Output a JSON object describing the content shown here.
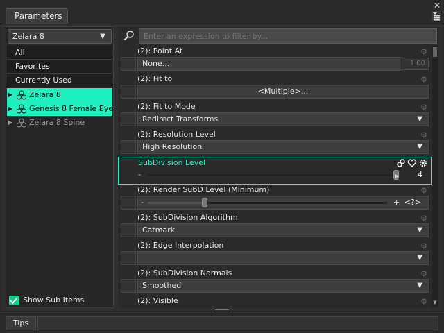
{
  "window": {
    "tab_label": "Parameters",
    "close_glyph": "✕"
  },
  "left": {
    "node_dropdown": "Zelara 8",
    "groups": [
      "All",
      "Favorites",
      "Currently Used"
    ],
    "tree": [
      {
        "label": "Zelara 8",
        "selected": true
      },
      {
        "label": "Genesis 8 Female Eye...",
        "selected": true
      },
      {
        "label": "Zelara 8 Spine",
        "selected": false
      }
    ],
    "show_sub_items": "Show Sub Items",
    "show_sub_checked": true
  },
  "filter": {
    "placeholder": "Enter an expression to filter by..."
  },
  "params": [
    {
      "label": "(2): Point At",
      "type": "text",
      "value": "None...",
      "num": "1.00"
    },
    {
      "label": "(2): Fit to",
      "type": "button",
      "value": "<Multiple>..."
    },
    {
      "label": "(2): Fit to Mode",
      "type": "dropdown",
      "value": "Redirect Transforms"
    },
    {
      "label": "(2): Resolution Level",
      "type": "dropdown",
      "value": "High Resolution"
    },
    {
      "label": "SubDivision Level",
      "type": "slider",
      "minus": "-",
      "value": "4",
      "level": 1.0
    },
    {
      "label": "(2): Render SubD Level (Minimum)",
      "type": "slider",
      "minus": "-",
      "plus": "+",
      "value": "<?>",
      "level": 0.23
    },
    {
      "label": "(2): SubDivision Algorithm",
      "type": "dropdown",
      "value": "Catmark"
    },
    {
      "label": "(2): Edge Interpolation",
      "type": "dropdown",
      "value": ""
    },
    {
      "label": "(2): SubDivision Normals",
      "type": "dropdown",
      "value": "Smoothed"
    },
    {
      "label": "(2): Visible",
      "type": "dropdown",
      "value": ""
    }
  ],
  "footer": {
    "tips_label": "Tips"
  },
  "colors": {
    "accent": "#1ef0c0",
    "panel_bg": "#2a2a2a"
  }
}
